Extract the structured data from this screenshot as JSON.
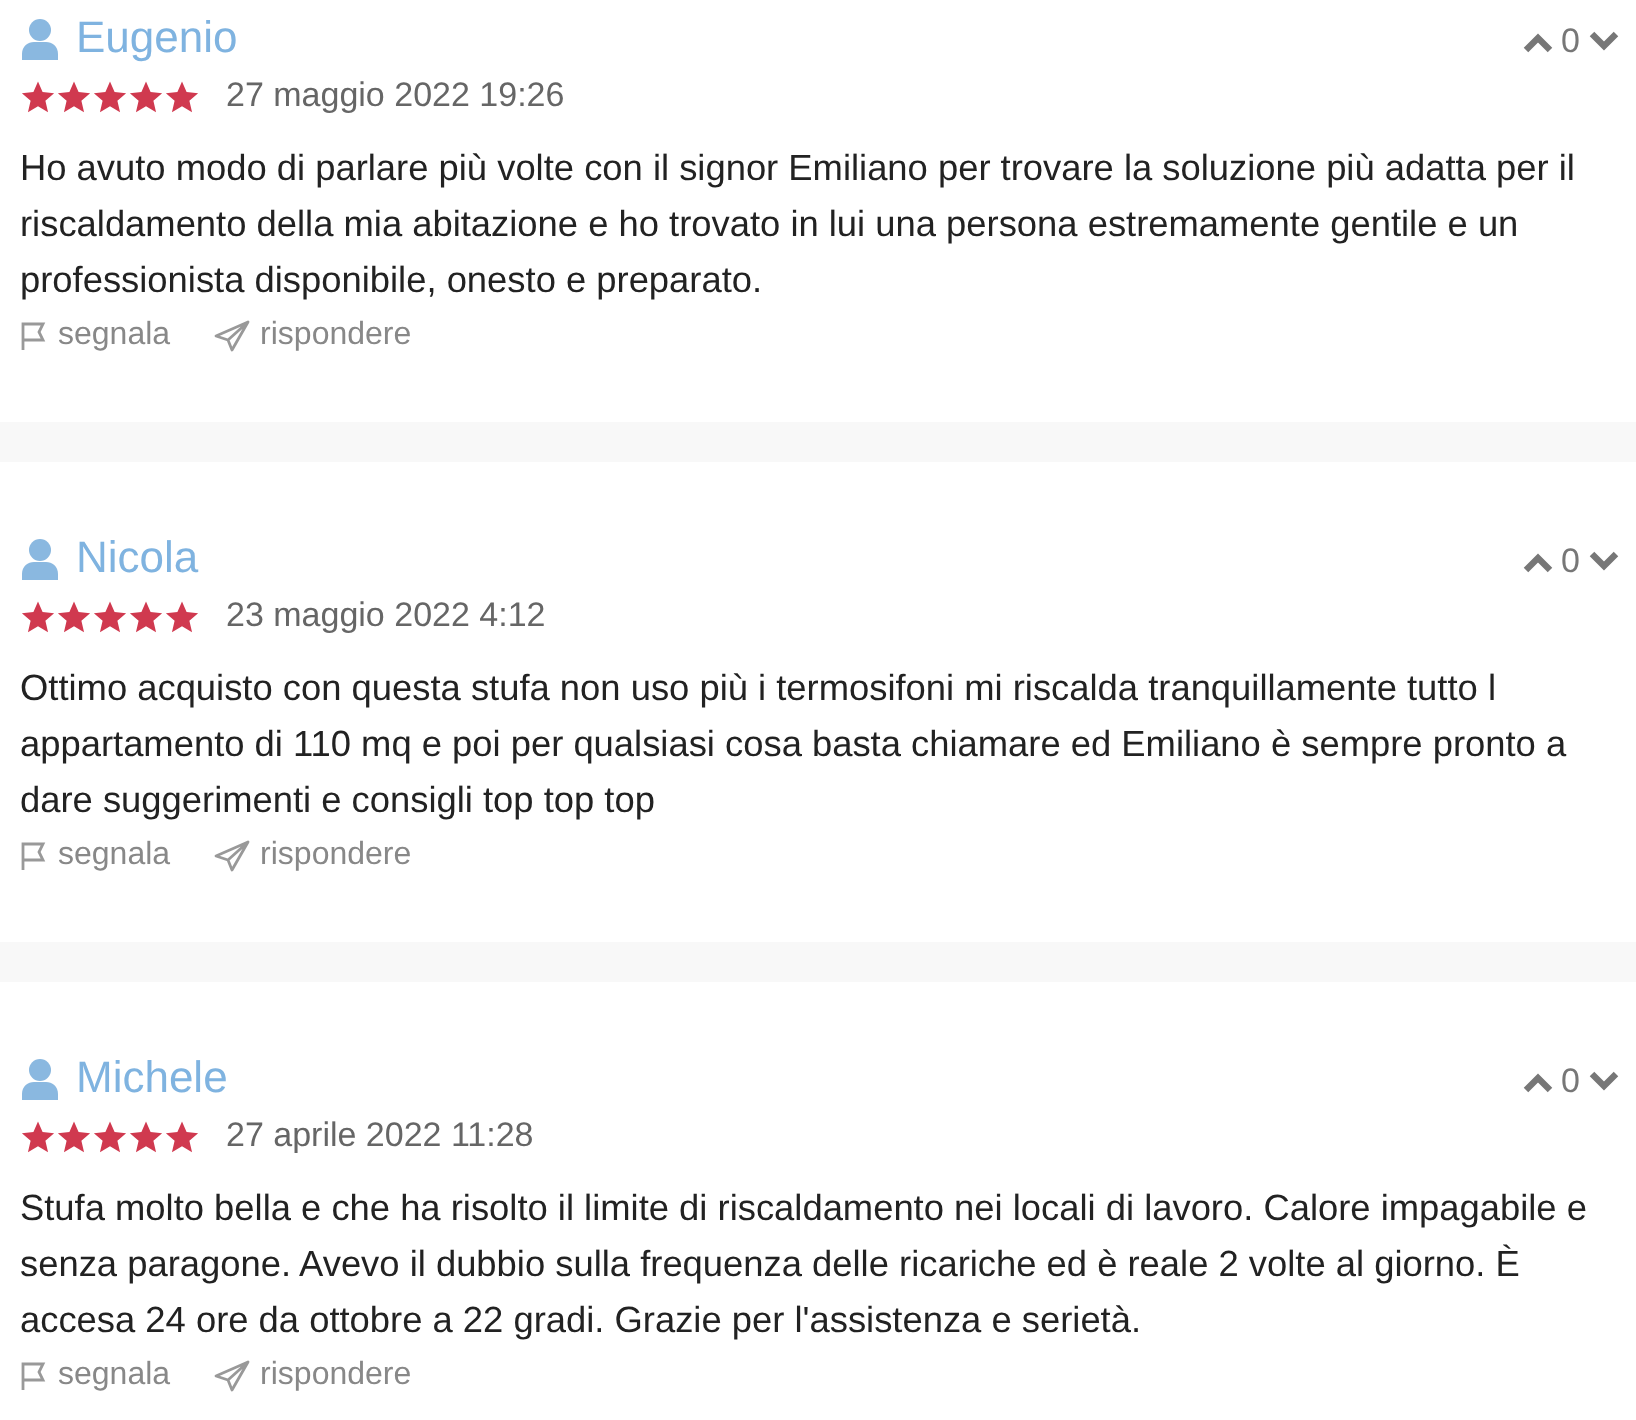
{
  "reviews": [
    {
      "author": "Eugenio",
      "stars": 5,
      "date": "27 maggio 2022 19:26",
      "votes": "0",
      "text": "Ho avuto modo di parlare più volte con il signor Emiliano per trovare la soluzione più adatta per il riscaldamento della mia abitazione e ho trovato in lui una persona estremamente gentile e un professionista disponibile, onesto e preparato.",
      "actions": [
        "segnala",
        "rispondere"
      ]
    },
    {
      "author": "Nicola",
      "stars": 5,
      "date": "23 maggio 2022 4:12",
      "votes": "0",
      "text": "Ottimo acquisto con questa stufa non uso più i termosifoni mi riscalda tranquillamente tutto l appartamento di 110 mq e poi per qualsiasi cosa basta chiamare ed Emiliano è sempre pronto a dare suggerimenti e consigli top top top",
      "actions": [
        "segnala",
        "rispondere"
      ]
    },
    {
      "author": "Michele",
      "stars": 5,
      "date": "27 aprile 2022 11:28",
      "votes": "0",
      "text": "Stufa molto bella e che ha risolto il limite di riscaldamento nei locali di lavoro. Calore impagabile e senza paragone. Avevo il dubbio sulla frequenza delle ricariche ed è reale 2 volte al giorno. È accesa 24 ore da ottobre a 22 gradi. Grazie per l'assistenza e serietà.",
      "actions": [
        "segnala",
        "rispondere"
      ]
    }
  ]
}
